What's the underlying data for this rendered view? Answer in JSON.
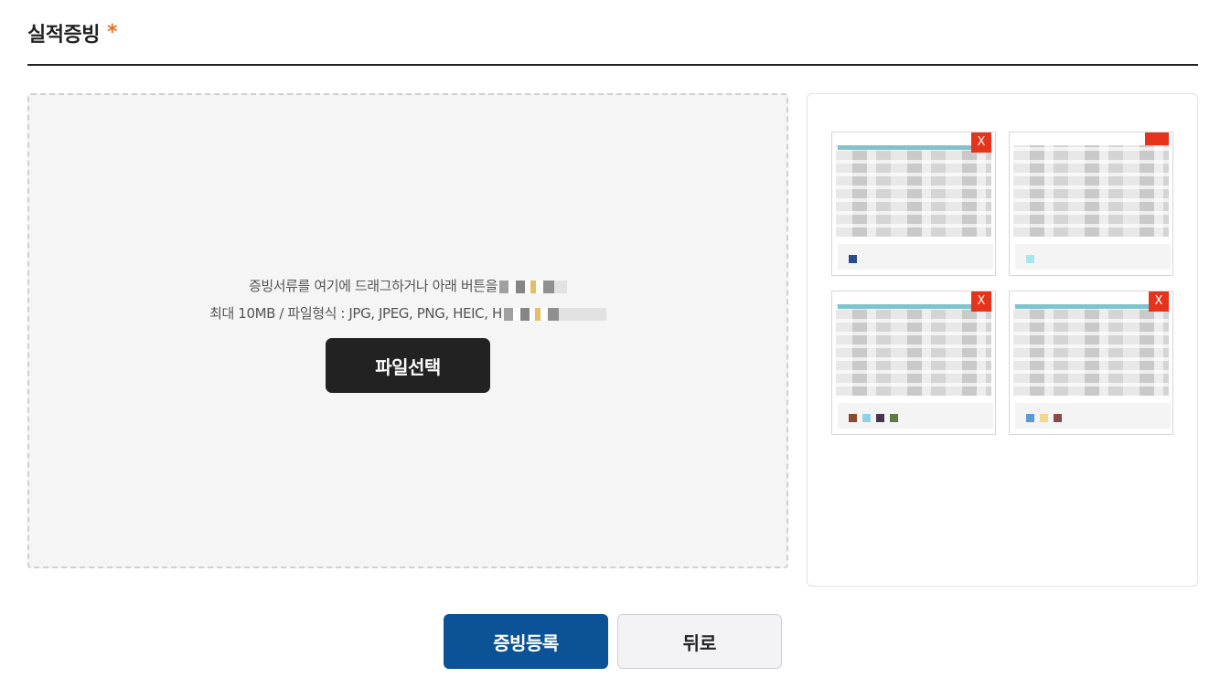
{
  "section": {
    "title": "실적증빙",
    "required_mark": "*",
    "accent_color": "#e8711e"
  },
  "dropzone": {
    "line1": "증빙서류를 여기에 드래그하거나 아래 버튼을",
    "line2": "최대 10MB / 파일형식 : JPG, JPEG, PNG, HEIC, H",
    "select_button": "파일선택"
  },
  "thumbnails": [
    {
      "remove_label": "X",
      "swatches": [
        "#2d4b8a"
      ]
    },
    {
      "remove_label": "",
      "swatches": [
        "#a8e6ee"
      ]
    },
    {
      "remove_label": "X",
      "swatches": [
        "#8a4a2c",
        "#8fd0e6",
        "#4a3350",
        "#5e7a45"
      ]
    },
    {
      "remove_label": "X",
      "swatches": [
        "#5b9bd5",
        "#f2d88a",
        "#8a4a4a"
      ]
    }
  ],
  "actions": {
    "submit_label": "증빙등록",
    "back_label": "뒤로",
    "submit_color": "#0c5297"
  }
}
